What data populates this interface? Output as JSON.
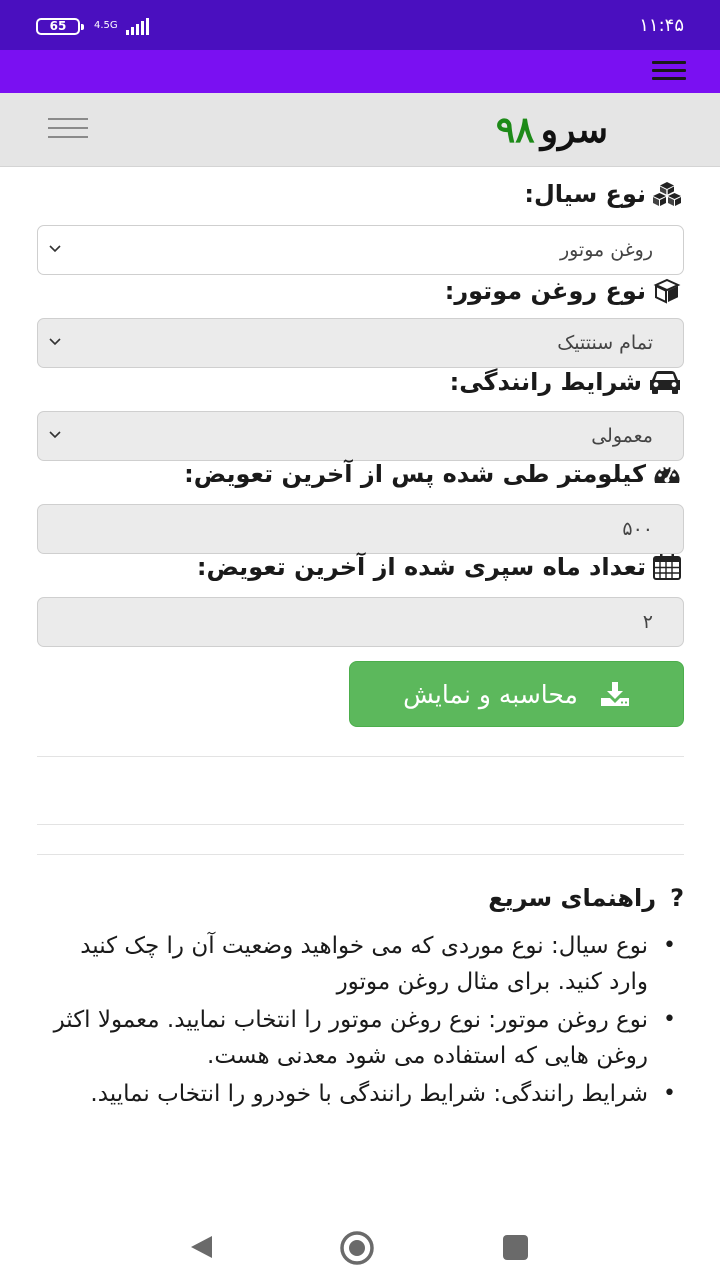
{
  "status_bar": {
    "battery": "65",
    "network": "4.5G",
    "time": "۱۱:۴۵"
  },
  "header": {
    "logo_text": "سرو",
    "logo_number": "۹۸"
  },
  "form": {
    "fluid_type": {
      "label": "نوع سیال:",
      "value": "روغن موتور",
      "icon": "cubes-icon"
    },
    "oil_type": {
      "label": "نوع روغن موتور:",
      "value": "تمام سنتتیک",
      "icon": "cube-icon"
    },
    "driving_conditions": {
      "label": "شرایط رانندگی:",
      "value": "معمولی",
      "icon": "car-icon"
    },
    "km_since_change": {
      "label": "کیلومتر طی شده پس از آخرین تعویض:",
      "value": "۵۰۰",
      "icon": "tachometer-icon"
    },
    "months_since_change": {
      "label": "تعداد ماه سپری شده از آخرین تعویض:",
      "value": "۲",
      "icon": "calendar-icon"
    },
    "submit_label": "محاسبه و نمایش"
  },
  "guide": {
    "title": "راهنمای سریع",
    "items": [
      "نوع سیال: نوع موردی که می خواهید وضعیت آن را چک کنید وارد کنید. برای مثال روغن موتور",
      "نوع روغن موتور: نوع روغن موتور را انتخاب نمایید. معمولا اکثر روغن هایی که استفاده می شود معدنی هست.",
      "شرایط رانندگی: شرایط رانندگی با خودرو را انتخاب نمایید."
    ]
  },
  "colors": {
    "status_bar": "#4a0fbf",
    "top_nav": "#7a10f2",
    "accent_green": "#5cb85c",
    "logo_green": "#1d8a18"
  }
}
